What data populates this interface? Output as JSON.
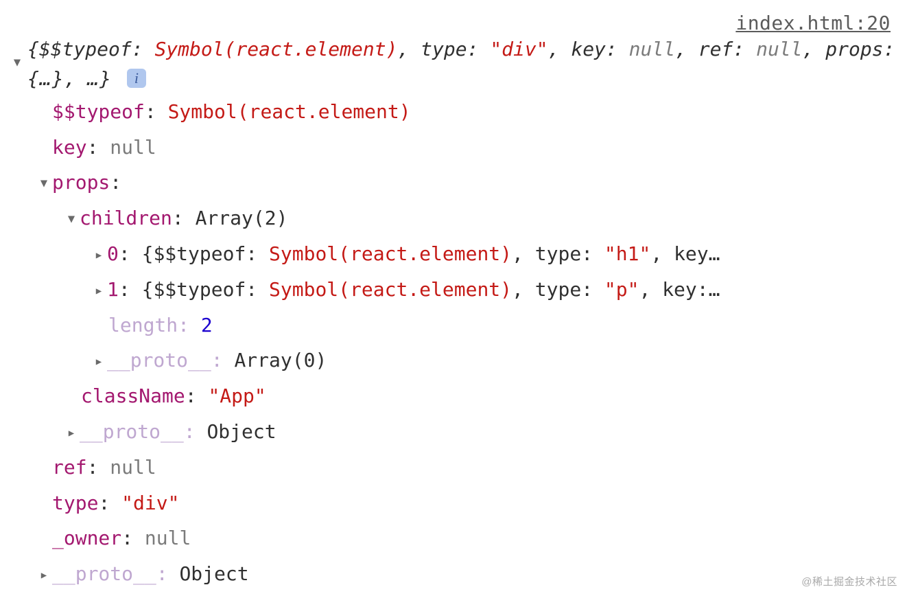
{
  "source_link": "index.html:20",
  "header": {
    "typeof_key": "$$typeof",
    "typeof_val": "Symbol(react.element)",
    "type_key": "type",
    "type_val": "\"div\"",
    "key_key": "key",
    "key_nullval": "null",
    "ref_key": "ref",
    "ref_nullval": "null",
    "props_key": "props",
    "props_val": "{…}",
    "ellipsis": "…",
    "info_glyph": "i"
  },
  "rows": {
    "typeof_key": "$$typeof",
    "typeof_val": "Symbol(react.element)",
    "key_key": "key",
    "key_val": "null",
    "props_key": "props",
    "children_key": "children",
    "children_val": "Array(2)",
    "child0_idx": "0",
    "child0_typeof_key": "$$typeof",
    "child0_typeof_val": "Symbol(react.element)",
    "child0_type_key": "type",
    "child0_type_val": "\"h1\"",
    "child0_rest": "key…",
    "child1_idx": "1",
    "child1_typeof_key": "$$typeof",
    "child1_typeof_val": "Symbol(react.element)",
    "child1_type_key": "type",
    "child1_type_val": "\"p\"",
    "child1_rest": "key:…",
    "length_key": "length",
    "length_val": "2",
    "proto_key": "__proto__",
    "children_proto_val": "Array(0)",
    "className_key": "className",
    "className_val": "\"App\"",
    "props_proto_val": "Object",
    "ref_key": "ref",
    "ref_val": "null",
    "type_key": "type",
    "type_val": "\"div\"",
    "owner_key": "_owner",
    "owner_val": "null",
    "root_proto_val": "Object"
  },
  "watermark": "@稀土掘金技术社区",
  "punct": {
    "colon": ":",
    "comma": ",",
    "lbrace": "{",
    "rbrace": "}",
    "sp": " "
  }
}
